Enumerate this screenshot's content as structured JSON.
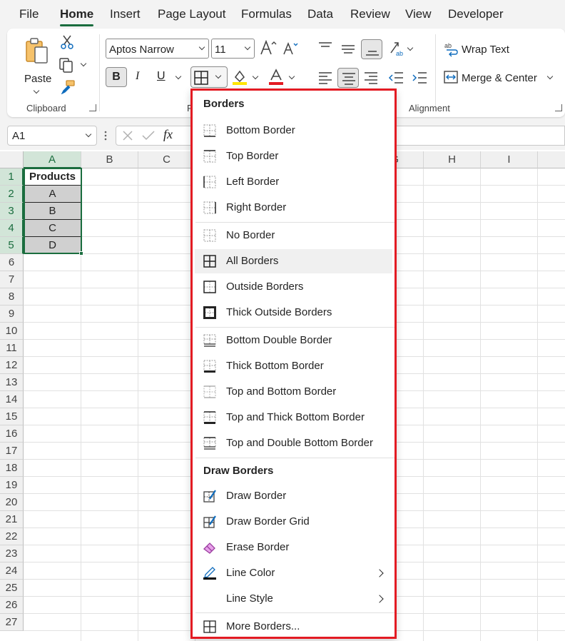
{
  "tabs": [
    "File",
    "Home",
    "Insert",
    "Page Layout",
    "Formulas",
    "Data",
    "Review",
    "View",
    "Developer"
  ],
  "active_tab": "Home",
  "ribbon": {
    "clipboard": {
      "paste_label": "Paste",
      "group_label": "Clipboard"
    },
    "font": {
      "name": "Aptos Narrow",
      "size": "11",
      "group_label": "F"
    },
    "alignment": {
      "wrap_text_label": "Wrap Text",
      "merge_center_label": "Merge & Center",
      "group_label": "Alignment"
    },
    "colors": {
      "accent": "#1a6d3e",
      "highlight": "#ffe600",
      "font_color": "#e31b23"
    }
  },
  "formula_bar": {
    "name_box": "A1",
    "fx_label": "fx"
  },
  "grid": {
    "columns": [
      "A",
      "B",
      "C",
      "G",
      "H",
      "I"
    ],
    "rows": [
      "1",
      "2",
      "3",
      "4",
      "5",
      "6",
      "7",
      "8",
      "9",
      "10",
      "11",
      "12",
      "13",
      "14",
      "15",
      "16",
      "17",
      "18",
      "19",
      "20",
      "21",
      "22",
      "23",
      "24",
      "25",
      "26",
      "27"
    ],
    "header_cell": "Products",
    "data_cells": [
      "A",
      "B",
      "C",
      "D"
    ]
  },
  "menu": {
    "section_borders": "Borders",
    "section_draw": "Draw Borders",
    "items": {
      "bottom": "Bottom Border",
      "top": "Top Border",
      "left": "Left Border",
      "right": "Right Border",
      "none": "No Border",
      "all": "All Borders",
      "outside": "Outside Borders",
      "thick_outside": "Thick Outside Borders",
      "bottom_double": "Bottom Double Border",
      "thick_bottom": "Thick Bottom Border",
      "top_bottom": "Top and Bottom Border",
      "top_thick_bottom": "Top and Thick Bottom Border",
      "top_double_bottom": "Top and Double Bottom Border",
      "draw_border": "Draw Border",
      "draw_grid": "Draw Border Grid",
      "erase": "Erase Border",
      "line_color": "Line Color",
      "line_style": "Line Style",
      "more": "More Borders..."
    },
    "highlight_color": "#e31b23"
  }
}
